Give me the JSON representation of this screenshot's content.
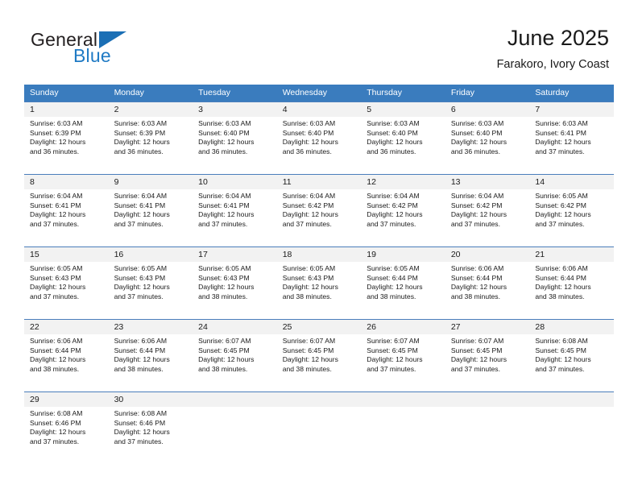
{
  "brand": {
    "name_part1": "General",
    "name_part2": "Blue",
    "mark": "triangle-logo"
  },
  "header": {
    "title": "June 2025",
    "subtitle": "Farakoro, Ivory Coast"
  },
  "theme": {
    "header_blue": "#3a7cbe",
    "row_border_blue": "#4a7ebb",
    "number_row_gray": "#f2f2f2",
    "brand_blue": "#1f7ac4",
    "text": "#1a1a1a"
  },
  "calendar": {
    "day_names": [
      "Sunday",
      "Monday",
      "Tuesday",
      "Wednesday",
      "Thursday",
      "Friday",
      "Saturday"
    ],
    "weeks": [
      {
        "days": [
          {
            "num": "1",
            "sunrise": "Sunrise: 6:03 AM",
            "sunset": "Sunset: 6:39 PM",
            "daylight1": "Daylight: 12 hours",
            "daylight2": "and 36 minutes."
          },
          {
            "num": "2",
            "sunrise": "Sunrise: 6:03 AM",
            "sunset": "Sunset: 6:39 PM",
            "daylight1": "Daylight: 12 hours",
            "daylight2": "and 36 minutes."
          },
          {
            "num": "3",
            "sunrise": "Sunrise: 6:03 AM",
            "sunset": "Sunset: 6:40 PM",
            "daylight1": "Daylight: 12 hours",
            "daylight2": "and 36 minutes."
          },
          {
            "num": "4",
            "sunrise": "Sunrise: 6:03 AM",
            "sunset": "Sunset: 6:40 PM",
            "daylight1": "Daylight: 12 hours",
            "daylight2": "and 36 minutes."
          },
          {
            "num": "5",
            "sunrise": "Sunrise: 6:03 AM",
            "sunset": "Sunset: 6:40 PM",
            "daylight1": "Daylight: 12 hours",
            "daylight2": "and 36 minutes."
          },
          {
            "num": "6",
            "sunrise": "Sunrise: 6:03 AM",
            "sunset": "Sunset: 6:40 PM",
            "daylight1": "Daylight: 12 hours",
            "daylight2": "and 36 minutes."
          },
          {
            "num": "7",
            "sunrise": "Sunrise: 6:03 AM",
            "sunset": "Sunset: 6:41 PM",
            "daylight1": "Daylight: 12 hours",
            "daylight2": "and 37 minutes."
          }
        ]
      },
      {
        "days": [
          {
            "num": "8",
            "sunrise": "Sunrise: 6:04 AM",
            "sunset": "Sunset: 6:41 PM",
            "daylight1": "Daylight: 12 hours",
            "daylight2": "and 37 minutes."
          },
          {
            "num": "9",
            "sunrise": "Sunrise: 6:04 AM",
            "sunset": "Sunset: 6:41 PM",
            "daylight1": "Daylight: 12 hours",
            "daylight2": "and 37 minutes."
          },
          {
            "num": "10",
            "sunrise": "Sunrise: 6:04 AM",
            "sunset": "Sunset: 6:41 PM",
            "daylight1": "Daylight: 12 hours",
            "daylight2": "and 37 minutes."
          },
          {
            "num": "11",
            "sunrise": "Sunrise: 6:04 AM",
            "sunset": "Sunset: 6:42 PM",
            "daylight1": "Daylight: 12 hours",
            "daylight2": "and 37 minutes."
          },
          {
            "num": "12",
            "sunrise": "Sunrise: 6:04 AM",
            "sunset": "Sunset: 6:42 PM",
            "daylight1": "Daylight: 12 hours",
            "daylight2": "and 37 minutes."
          },
          {
            "num": "13",
            "sunrise": "Sunrise: 6:04 AM",
            "sunset": "Sunset: 6:42 PM",
            "daylight1": "Daylight: 12 hours",
            "daylight2": "and 37 minutes."
          },
          {
            "num": "14",
            "sunrise": "Sunrise: 6:05 AM",
            "sunset": "Sunset: 6:42 PM",
            "daylight1": "Daylight: 12 hours",
            "daylight2": "and 37 minutes."
          }
        ]
      },
      {
        "days": [
          {
            "num": "15",
            "sunrise": "Sunrise: 6:05 AM",
            "sunset": "Sunset: 6:43 PM",
            "daylight1": "Daylight: 12 hours",
            "daylight2": "and 37 minutes."
          },
          {
            "num": "16",
            "sunrise": "Sunrise: 6:05 AM",
            "sunset": "Sunset: 6:43 PM",
            "daylight1": "Daylight: 12 hours",
            "daylight2": "and 37 minutes."
          },
          {
            "num": "17",
            "sunrise": "Sunrise: 6:05 AM",
            "sunset": "Sunset: 6:43 PM",
            "daylight1": "Daylight: 12 hours",
            "daylight2": "and 38 minutes."
          },
          {
            "num": "18",
            "sunrise": "Sunrise: 6:05 AM",
            "sunset": "Sunset: 6:43 PM",
            "daylight1": "Daylight: 12 hours",
            "daylight2": "and 38 minutes."
          },
          {
            "num": "19",
            "sunrise": "Sunrise: 6:05 AM",
            "sunset": "Sunset: 6:44 PM",
            "daylight1": "Daylight: 12 hours",
            "daylight2": "and 38 minutes."
          },
          {
            "num": "20",
            "sunrise": "Sunrise: 6:06 AM",
            "sunset": "Sunset: 6:44 PM",
            "daylight1": "Daylight: 12 hours",
            "daylight2": "and 38 minutes."
          },
          {
            "num": "21",
            "sunrise": "Sunrise: 6:06 AM",
            "sunset": "Sunset: 6:44 PM",
            "daylight1": "Daylight: 12 hours",
            "daylight2": "and 38 minutes."
          }
        ]
      },
      {
        "days": [
          {
            "num": "22",
            "sunrise": "Sunrise: 6:06 AM",
            "sunset": "Sunset: 6:44 PM",
            "daylight1": "Daylight: 12 hours",
            "daylight2": "and 38 minutes."
          },
          {
            "num": "23",
            "sunrise": "Sunrise: 6:06 AM",
            "sunset": "Sunset: 6:44 PM",
            "daylight1": "Daylight: 12 hours",
            "daylight2": "and 38 minutes."
          },
          {
            "num": "24",
            "sunrise": "Sunrise: 6:07 AM",
            "sunset": "Sunset: 6:45 PM",
            "daylight1": "Daylight: 12 hours",
            "daylight2": "and 38 minutes."
          },
          {
            "num": "25",
            "sunrise": "Sunrise: 6:07 AM",
            "sunset": "Sunset: 6:45 PM",
            "daylight1": "Daylight: 12 hours",
            "daylight2": "and 38 minutes."
          },
          {
            "num": "26",
            "sunrise": "Sunrise: 6:07 AM",
            "sunset": "Sunset: 6:45 PM",
            "daylight1": "Daylight: 12 hours",
            "daylight2": "and 37 minutes."
          },
          {
            "num": "27",
            "sunrise": "Sunrise: 6:07 AM",
            "sunset": "Sunset: 6:45 PM",
            "daylight1": "Daylight: 12 hours",
            "daylight2": "and 37 minutes."
          },
          {
            "num": "28",
            "sunrise": "Sunrise: 6:08 AM",
            "sunset": "Sunset: 6:45 PM",
            "daylight1": "Daylight: 12 hours",
            "daylight2": "and 37 minutes."
          }
        ]
      },
      {
        "days": [
          {
            "num": "29",
            "sunrise": "Sunrise: 6:08 AM",
            "sunset": "Sunset: 6:46 PM",
            "daylight1": "Daylight: 12 hours",
            "daylight2": "and 37 minutes."
          },
          {
            "num": "30",
            "sunrise": "Sunrise: 6:08 AM",
            "sunset": "Sunset: 6:46 PM",
            "daylight1": "Daylight: 12 hours",
            "daylight2": "and 37 minutes."
          },
          {
            "num": "",
            "sunrise": "",
            "sunset": "",
            "daylight1": "",
            "daylight2": ""
          },
          {
            "num": "",
            "sunrise": "",
            "sunset": "",
            "daylight1": "",
            "daylight2": ""
          },
          {
            "num": "",
            "sunrise": "",
            "sunset": "",
            "daylight1": "",
            "daylight2": ""
          },
          {
            "num": "",
            "sunrise": "",
            "sunset": "",
            "daylight1": "",
            "daylight2": ""
          },
          {
            "num": "",
            "sunrise": "",
            "sunset": "",
            "daylight1": "",
            "daylight2": ""
          }
        ]
      }
    ]
  }
}
